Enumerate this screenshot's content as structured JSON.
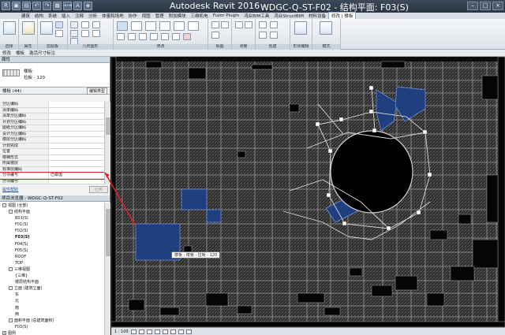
{
  "window": {
    "app_title": "Autodesk Revit 2016 -",
    "doc_title": "WDGC-Q-ST-F02 - 结构平面: F03(S)"
  },
  "menu": {
    "app_button": "R",
    "tabs": [
      "建筑",
      "结构",
      "系统",
      "插入",
      "注释",
      "分析",
      "体量和场地",
      "协作",
      "视图",
      "管理",
      "附加模块",
      "三维机电",
      "Fuzor Plugin",
      "鸿业BIM工具",
      "鸿业StructBIM",
      "材料设备",
      "修改 | 楼板"
    ],
    "active_index": 16
  },
  "ribbon": {
    "groups": [
      "选择",
      "属性",
      "剪贴板",
      "几何图形",
      "修改",
      "视图",
      "测量",
      "创建",
      "形状编辑",
      "模式"
    ],
    "labels": {
      "modify": "修改",
      "paste": "粘贴",
      "cut": "✂",
      "join": "连接",
      "filter": "过滤器",
      "edit_boundary": "编辑边界",
      "properties": "属性"
    }
  },
  "modebar": {
    "items": [
      "修改",
      "楼板",
      "激活尺寸标注"
    ]
  },
  "properties": {
    "title": "属性",
    "type_name": "楼板",
    "type_sub": "拉板 - 120",
    "selector": "楼板 (44)",
    "edit_type": "编辑类型",
    "rows": [
      {
        "k": "分区编码",
        "v": ""
      },
      {
        "k": "清单编码",
        "v": ""
      },
      {
        "k": "清单分区编码",
        "v": ""
      },
      {
        "k": "计划分区编码",
        "v": ""
      },
      {
        "k": "图纸分区编码",
        "v": ""
      },
      {
        "k": "设计分区编码",
        "v": ""
      },
      {
        "k": "楼层分区编码",
        "v": ""
      },
      {
        "k": "计划完成",
        "v": ""
      },
      {
        "k": "位置",
        "v": ""
      },
      {
        "k": "楼梯形式",
        "v": ""
      },
      {
        "k": "所属楼层",
        "v": ""
      },
      {
        "k": "标准层编码",
        "v": ""
      },
      {
        "k": "分项编号",
        "v": "已赋值"
      },
      {
        "k": "分项编号",
        "v": ""
      },
      {
        "k": "构件编号",
        "v": ""
      }
    ],
    "highlight_index": 12,
    "help_link": "属性帮助",
    "apply": "应用"
  },
  "browser": {
    "title": "项目浏览器 - WDGC-Q-ST-F02",
    "items": [
      {
        "t": "视图 (全部)",
        "lvl": 0,
        "tg": "-"
      },
      {
        "t": "结构平面",
        "lvl": 1,
        "tg": "-"
      },
      {
        "t": "B01(S)",
        "lvl": 2,
        "tg": ""
      },
      {
        "t": "F01(S)",
        "lvl": 2,
        "tg": ""
      },
      {
        "t": "F02(S)",
        "lvl": 2,
        "tg": ""
      },
      {
        "t": "F03(S)",
        "lvl": 2,
        "tg": "",
        "bold": true
      },
      {
        "t": "F04(S)",
        "lvl": 2,
        "tg": ""
      },
      {
        "t": "F05(S)",
        "lvl": 2,
        "tg": ""
      },
      {
        "t": "ROOF",
        "lvl": 2,
        "tg": ""
      },
      {
        "t": "TOP",
        "lvl": 2,
        "tg": ""
      },
      {
        "t": "三维视图",
        "lvl": 1,
        "tg": "-"
      },
      {
        "t": "{三维}",
        "lvl": 2,
        "tg": ""
      },
      {
        "t": "楼层结构平面",
        "lvl": 2,
        "tg": ""
      },
      {
        "t": "立面 (建筑立面)",
        "lvl": 1,
        "tg": "-"
      },
      {
        "t": "东",
        "lvl": 2,
        "tg": ""
      },
      {
        "t": "北",
        "lvl": 2,
        "tg": ""
      },
      {
        "t": "南",
        "lvl": 2,
        "tg": ""
      },
      {
        "t": "西",
        "lvl": 2,
        "tg": ""
      },
      {
        "t": "面积平面 (总建筑面积)",
        "lvl": 1,
        "tg": "-"
      },
      {
        "t": "F03(S)",
        "lvl": 2,
        "tg": ""
      },
      {
        "t": "图例",
        "lvl": 0,
        "tg": "+"
      }
    ]
  },
  "canvas": {
    "tooltip": "楼板 : 楼板 : 拉板 - 120"
  },
  "viewbar": {
    "scale": "1 : 100"
  },
  "colors": {
    "selected_slab": "#203f7e",
    "drawing_bg": "#0c0c0c",
    "highlight": "#dd2222"
  }
}
